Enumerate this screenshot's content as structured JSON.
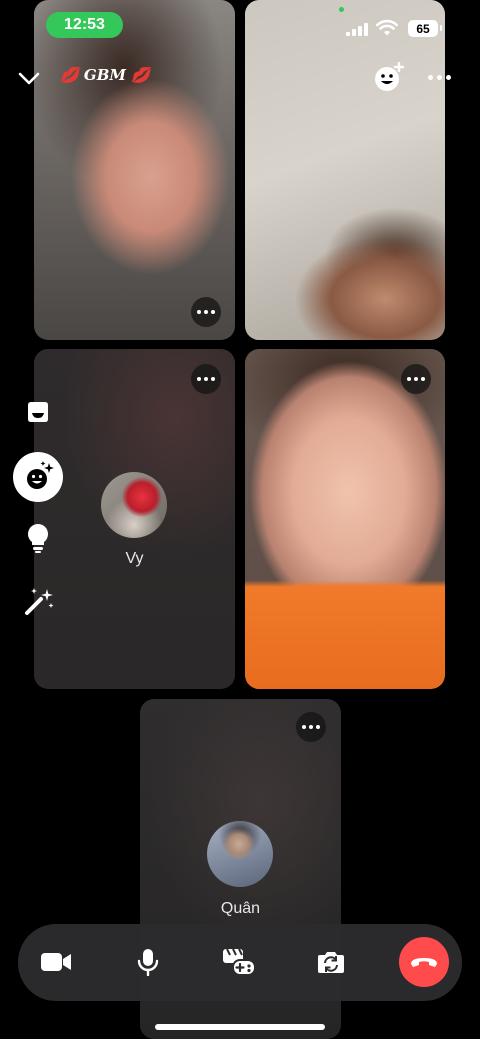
{
  "status_bar": {
    "time": "12:53",
    "battery": "65"
  },
  "header": {
    "group_name": "💋 GBM 💋"
  },
  "participants": [
    {
      "type": "video"
    },
    {
      "type": "video"
    },
    {
      "type": "avatar",
      "name": "Vy"
    },
    {
      "type": "video"
    },
    {
      "type": "avatar",
      "name": "Quân"
    }
  ],
  "side_tools": [
    "chat-bubble-icon",
    "effects-icon",
    "lightbulb-icon",
    "magic-wand-icon"
  ],
  "controls": [
    "video-camera-icon",
    "microphone-icon",
    "games-icon",
    "flip-camera-icon",
    "end-call-icon"
  ],
  "colors": {
    "end_call": "#ff4b4b",
    "status_time": "#34c759",
    "control_bar": "#2c2c2e"
  }
}
